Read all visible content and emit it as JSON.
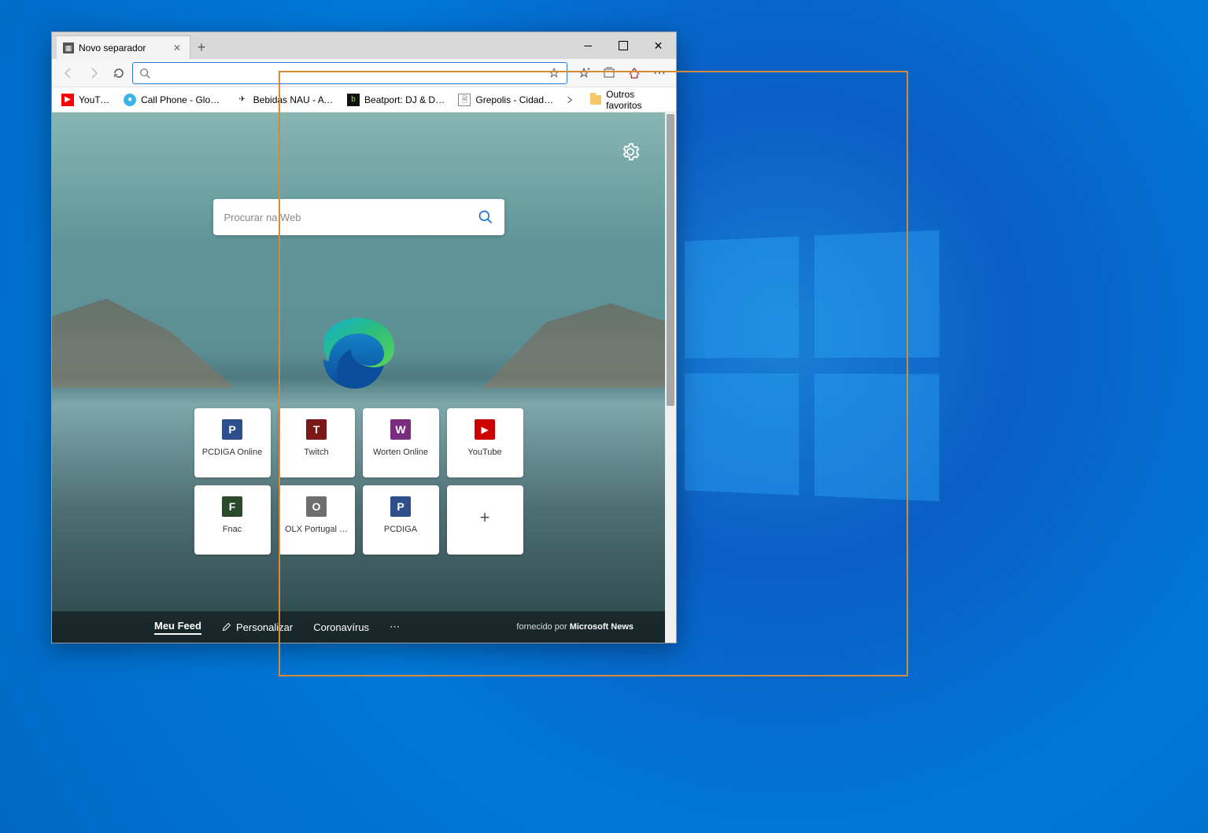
{
  "tab": {
    "title": "Novo separador"
  },
  "addressbar": {
    "value": ""
  },
  "bookmarks": {
    "items": [
      {
        "label": "YouTube",
        "iconBg": "#ff0000"
      },
      {
        "label": "Call Phone - Globfo…",
        "iconBg": "#39b4e6"
      },
      {
        "label": "Bebidas NAU - A pr…",
        "iconBg": "#222"
      },
      {
        "label": "Beatport: DJ & Dan…",
        "iconBg": "#111"
      },
      {
        "label": "Grepolis - Cidade d…",
        "iconBg": "#fff"
      }
    ],
    "other_label": "Outros favoritos"
  },
  "search": {
    "placeholder": "Procurar na Web"
  },
  "tiles": [
    {
      "label": "PCDIGA Online",
      "letter": "P",
      "bg": "#2f4e8c"
    },
    {
      "label": "Twitch",
      "letter": "T",
      "bg": "#7a1717"
    },
    {
      "label": "Worten Online",
      "letter": "W",
      "bg": "#7a2c7e"
    },
    {
      "label": "YouTube",
      "letter": "▶",
      "bg": "#cc0000"
    },
    {
      "label": "Fnac",
      "letter": "F",
      "bg": "#2a4a2a"
    },
    {
      "label": "OLX Portugal …",
      "letter": "O",
      "bg": "#6e6e6e"
    },
    {
      "label": "PCDIGA",
      "letter": "P",
      "bg": "#2f4e8c"
    }
  ],
  "feedbar": {
    "my_feed": "Meu Feed",
    "personalize": "Personalizar",
    "coronavirus": "Coronavírus",
    "provider_prefix": "fornecido por",
    "provider_name": "Microsoft News"
  }
}
